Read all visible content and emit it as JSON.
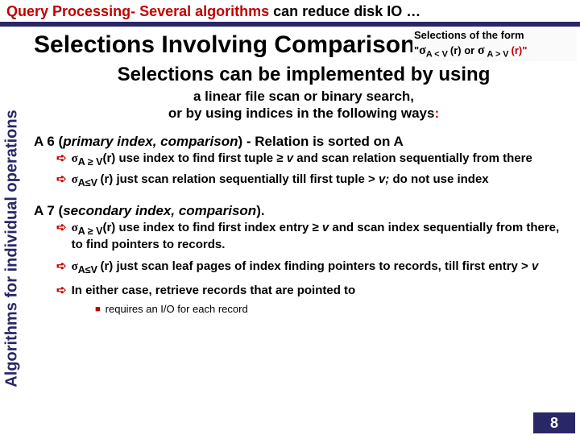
{
  "topbar": {
    "red1": "Query Processing-",
    "red2": " Several algorithms",
    "black": " can reduce disk IO …"
  },
  "sideLabel": "Algorithms for individual operations",
  "title": "Selections Involving Comparisons",
  "formBox": {
    "line1": "Selections of the form",
    "quoteOpen": "\"",
    "sigma1": "σ",
    "sub1": "A < V ",
    "r1": "(r)",
    "or": " or ",
    "sigma2": "σ",
    "sub2": " A > V ",
    "r2": "(r)\""
  },
  "sub1": "Selections can be implemented by using",
  "sub2a": "a linear file scan or binary search,",
  "sub2b": "or by using indices in the following ways",
  "colon": ":",
  "a6": {
    "head1": "A 6 (",
    "headItal": "primary index, comparison",
    "head2": ") - Relation is",
    "headBold": " sorted",
    "head3": " on A",
    "b1a": "σ",
    "b1sub": "A ≥ V",
    "b1b": "(r)  use index",
    "b1c": " to find first tuple ≥ ",
    "b1d": "v",
    "b1e": "  and scan relation sequentially  from there",
    "b2a": "σ",
    "b2sub": "A≤V ",
    "b2b": "(r) just scan ",
    "b2c": "relation sequentially till first tuple > ",
    "b2d": "v",
    "b2e": "; ",
    "b2f": "do not use index"
  },
  "a7": {
    "head1": "A 7 (",
    "headItal": "secondary index, comparison",
    "head2": ").",
    "b1a": "σ",
    "b1sub": "A ≥ V",
    "b1b": "(r)  use index",
    "b1c": " to find first index entry ≥ ",
    "b1d": "v ",
    "b1e": "and scan index sequentially  from there, to find pointers to records.",
    "b2a": "σ",
    "b2sub": "A≤V ",
    "b2b": "(r) just scan ",
    "b2c": "leaf pages of index finding pointers to records, till first entry > ",
    "b2d": "v",
    "b3": "In either case, retrieve records that are pointed to",
    "sub": "requires an I/O for each record"
  },
  "pageNum": "8"
}
